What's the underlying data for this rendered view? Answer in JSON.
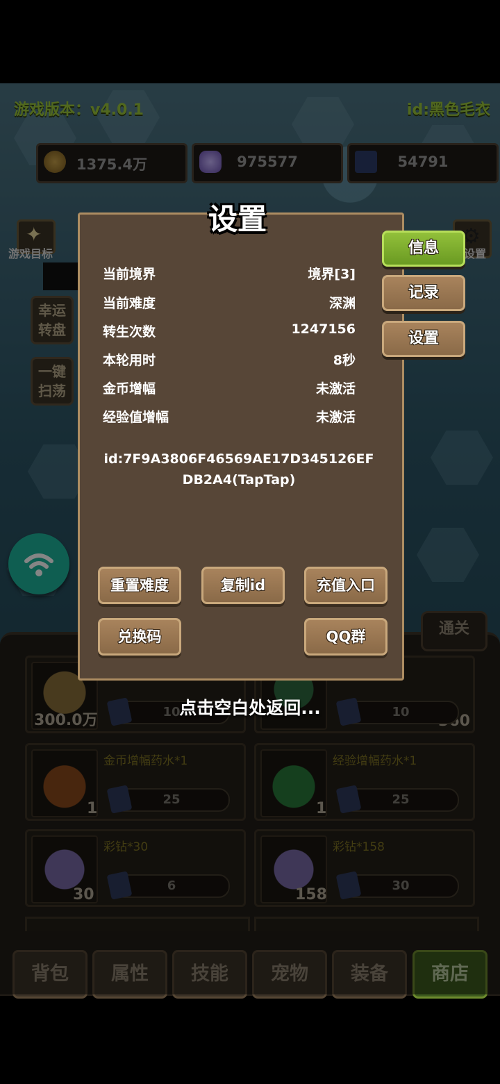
{
  "header": {
    "version": "游戏版本：v4.0.1",
    "player_id": "id:黑色毛衣"
  },
  "resources": {
    "coins": "1375.4万",
    "diamonds": "975577",
    "tickets": "54791"
  },
  "side": {
    "goal_label": "游戏目标",
    "lucky_wheel": "幸运转盘",
    "sweep": "一键扫荡",
    "settings_small": "设置"
  },
  "modal": {
    "title": "设置",
    "rows": [
      {
        "label": "当前境界",
        "value": "境界[3]"
      },
      {
        "label": "当前难度",
        "value": "深渊"
      },
      {
        "label": "转生次数",
        "value": "1247156"
      },
      {
        "label": "本轮用时",
        "value": "8秒"
      },
      {
        "label": "金币增幅",
        "value": "未激活"
      },
      {
        "label": "经验值增幅",
        "value": "未激活"
      }
    ],
    "id_text": "id:7F9A3806F46569AE17D345126EFDB2A4(TapTap)",
    "buttons": {
      "reset": "重置难度",
      "copy_id": "复制id",
      "recharge": "充值入口",
      "redeem": "兑换码",
      "qq": "QQ群"
    },
    "side_tabs": {
      "info": "信息",
      "record": "记录",
      "settings": "设置"
    }
  },
  "hint": "点击空白处返回...",
  "tonguan": "通关",
  "shop": {
    "items": [
      {
        "name": "",
        "qty": "300.0万",
        "price": "10"
      },
      {
        "name": "",
        "qty": "360",
        "price": "10"
      },
      {
        "name": "金币增幅药水*1",
        "qty": "1",
        "price": "25"
      },
      {
        "name": "经验增幅药水*1",
        "qty": "1",
        "price": "25"
      },
      {
        "name": "彩钻*30",
        "qty": "30",
        "price": "6"
      },
      {
        "name": "彩钻*158",
        "qty": "158",
        "price": "30"
      }
    ]
  },
  "tabs": [
    "背包",
    "属性",
    "技能",
    "宠物",
    "装备",
    "商店"
  ],
  "colors": {
    "accent_green": "#9bc83a",
    "modal_bg": "#574637",
    "active_tab": "#3d5a1e"
  }
}
